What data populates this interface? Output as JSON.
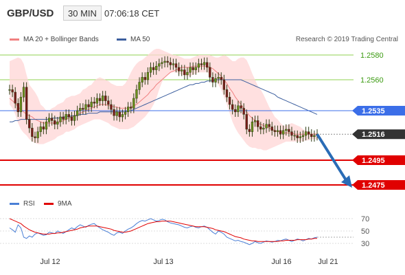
{
  "header": {
    "symbol": "GBP/USD",
    "timeframe": "30 MIN",
    "time": "07:06:18 CET"
  },
  "legend": {
    "bollinger": {
      "label": "MA 20 + Bollinger Bands",
      "color": "#f08080"
    },
    "ma50": {
      "label": "MA 50",
      "color": "#3b5e9e"
    },
    "rsi": {
      "label": "RSI",
      "color": "#4a7fd6"
    },
    "rsi_ma": {
      "label": "9MA",
      "color": "#e00000"
    }
  },
  "copyright": "Research © 2019 Trading Central",
  "chart_data": {
    "type": "candlestick",
    "y_range": [
      2.5445,
      2.559
    ],
    "price_ticks": [
      "1.2580",
      "1.2560"
    ],
    "x_ticks": [
      "Jul 12",
      "Jul 13",
      "Jul 16",
      "Jul 21"
    ],
    "closes": [
      1.2552,
      1.255,
      1.2541,
      1.2534,
      1.2546,
      1.2554,
      1.2528,
      1.2521,
      1.2514,
      1.2513,
      1.2518,
      1.2522,
      1.252,
      1.2526,
      1.2529,
      1.2527,
      1.2524,
      1.2526,
      1.253,
      1.2528,
      1.2532,
      1.253,
      1.2527,
      1.2531,
      1.2535,
      1.2537,
      1.2536,
      1.254,
      1.2538,
      1.2542,
      1.2541,
      1.2545,
      1.2543,
      1.2547,
      1.2543,
      1.254,
      1.2536,
      1.2531,
      1.2534,
      1.253,
      1.2532,
      1.2534,
      1.2538,
      1.2537,
      1.2545,
      1.2552,
      1.2558,
      1.2562,
      1.256,
      1.2566,
      1.257,
      1.2568,
      1.2571,
      1.2573,
      1.2574,
      1.2575,
      1.2574,
      1.2572,
      1.2573,
      1.257,
      1.2567,
      1.2568,
      1.2564,
      1.2566,
      1.257,
      1.2568,
      1.257,
      1.2573,
      1.2572,
      1.2574,
      1.257,
      1.2562,
      1.2558,
      1.2561,
      1.2562,
      1.256,
      1.2552,
      1.2546,
      1.254,
      1.2536,
      1.2534,
      1.2539,
      1.2537,
      1.2532,
      1.252,
      1.2518,
      1.2526,
      1.2527,
      1.2522,
      1.252,
      1.2521,
      1.2524,
      1.2522,
      1.2519,
      1.2518,
      1.2519,
      1.2516,
      1.2519,
      1.252,
      1.2518,
      1.2515,
      1.2515,
      1.2513,
      1.2514,
      1.2515,
      1.2518,
      1.2516,
      1.2514,
      1.2515,
      1.2516
    ],
    "ma20_upper": [
      1.2575,
      1.2576,
      1.2577,
      1.2578,
      1.2577,
      1.2573,
      1.2564,
      1.2556,
      1.2553,
      1.255,
      1.2546,
      1.254,
      1.2538,
      1.2535,
      1.2535,
      1.2537,
      1.2538,
      1.254,
      1.2541,
      1.2542,
      1.2545,
      1.2546,
      1.2547,
      1.2547,
      1.2548,
      1.2549,
      1.2552,
      1.2553,
      1.2555,
      1.2556,
      1.2559,
      1.2561,
      1.2562,
      1.2561,
      1.256,
      1.2559,
      1.2557,
      1.2556,
      1.2555,
      1.2555,
      1.2555,
      1.2557,
      1.2561,
      1.2566,
      1.257,
      1.2573,
      1.2575,
      1.2576,
      1.2578,
      1.258,
      1.2582,
      1.2584,
      1.2585,
      1.2585,
      1.2584,
      1.2583,
      1.2582,
      1.2581,
      1.258,
      1.258,
      1.2579,
      1.2578,
      1.2577,
      1.2577,
      1.2577,
      1.2578,
      1.2579,
      1.258,
      1.258,
      1.258,
      1.258,
      1.258,
      1.2579,
      1.2578,
      1.2578,
      1.2579,
      1.258,
      1.2579,
      1.2577,
      1.2575,
      1.2575,
      1.2577,
      1.2578,
      1.2578,
      1.2576,
      1.2571,
      1.2565,
      1.256,
      1.2555,
      1.2552,
      1.2548,
      1.2543,
      1.2538,
      1.2534,
      1.253,
      1.2528,
      1.2525,
      1.2523,
      1.2523,
      1.2524,
      1.2525,
      1.2524,
      1.2523,
      1.2522,
      1.252,
      1.2519,
      1.2518,
      1.2517,
      1.2517,
      1.2517
    ],
    "ma20_lower": [
      1.254,
      1.2537,
      1.2532,
      1.2525,
      1.252,
      1.2517,
      1.2515,
      1.2512,
      1.251,
      1.2509,
      1.2508,
      1.2508,
      1.2508,
      1.2509,
      1.251,
      1.2511,
      1.2512,
      1.2514,
      1.2515,
      1.2516,
      1.2518,
      1.2518,
      1.2519,
      1.252,
      1.2522,
      1.2523,
      1.2524,
      1.2525,
      1.2526,
      1.2527,
      1.2528,
      1.2528,
      1.2528,
      1.2527,
      1.2526,
      1.2525,
      1.2523,
      1.2522,
      1.2521,
      1.252,
      1.252,
      1.252,
      1.252,
      1.2521,
      1.2522,
      1.2524,
      1.2526,
      1.2528,
      1.253,
      1.2533,
      1.2536,
      1.254,
      1.2545,
      1.2552,
      1.2558,
      1.2562,
      1.2564,
      1.2566,
      1.2566,
      1.2566,
      1.2565,
      1.2564,
      1.2563,
      1.2563,
      1.2563,
      1.2564,
      1.2565,
      1.2566,
      1.2566,
      1.2566,
      1.2566,
      1.2565,
      1.2563,
      1.256,
      1.2556,
      1.2552,
      1.2546,
      1.254,
      1.2533,
      1.2526,
      1.2521,
      1.2517,
      1.2514,
      1.2511,
      1.2508,
      1.2506,
      1.2505,
      1.2505,
      1.2504,
      1.2504,
      1.2503,
      1.2503,
      1.2504,
      1.2505,
      1.2506,
      1.2507,
      1.2508,
      1.2509,
      1.251,
      1.251,
      1.251,
      1.251,
      1.251,
      1.251,
      1.251,
      1.2511,
      1.2511,
      1.2512,
      1.2512,
      1.2512
    ],
    "ma20": [
      1.2545,
      1.2543,
      1.2541,
      1.2538,
      1.2536,
      1.2534,
      1.2532,
      1.2531,
      1.253,
      1.2528,
      1.2527,
      1.2526,
      1.2525,
      1.2525,
      1.2525,
      1.2525,
      1.2525,
      1.2526,
      1.2526,
      1.2527,
      1.2528,
      1.2529,
      1.253,
      1.2531,
      1.2532,
      1.2533,
      1.2534,
      1.2535,
      1.2536,
      1.2537,
      1.2538,
      1.2539,
      1.254,
      1.254,
      1.254,
      1.2539,
      1.2539,
      1.2538,
      1.2538,
      1.2537,
      1.2537,
      1.2537,
      1.2537,
      1.2538,
      1.2539,
      1.254,
      1.2542,
      1.2544,
      1.2546,
      1.2548,
      1.2551,
      1.2553,
      1.2556,
      1.2558,
      1.256,
      1.2562,
      1.2564,
      1.2566,
      1.2567,
      1.2568,
      1.2569,
      1.257,
      1.257,
      1.257,
      1.257,
      1.2571,
      1.2571,
      1.2571,
      1.2571,
      1.2571,
      1.2571,
      1.257,
      1.2569,
      1.2567,
      1.2565,
      1.2563,
      1.256,
      1.2557,
      1.2553,
      1.255,
      1.2546,
      1.2543,
      1.254,
      1.2537,
      1.2534,
      1.2531,
      1.2529,
      1.2527,
      1.2525,
      1.2524,
      1.2523,
      1.2522,
      1.2521,
      1.252,
      1.2519,
      1.2518,
      1.2518,
      1.2517,
      1.2517,
      1.2517,
      1.2517,
      1.2516,
      1.2516,
      1.2516,
      1.2516,
      1.2516,
      1.2516,
      1.2516,
      1.2516,
      1.2516
    ],
    "ma50": [
      1.2526,
      1.2526,
      1.2527,
      1.2527,
      1.2528,
      1.2528,
      1.2528,
      1.2528,
      1.2528,
      1.2528,
      1.2528,
      1.2528,
      1.2528,
      1.2528,
      1.2528,
      1.2529,
      1.2529,
      1.2529,
      1.2529,
      1.253,
      1.253,
      1.253,
      1.2531,
      1.2531,
      1.2531,
      1.2532,
      1.2532,
      1.2532,
      1.2533,
      1.2533,
      1.2533,
      1.2533,
      1.2534,
      1.2534,
      1.2534,
      1.2534,
      1.2534,
      1.2534,
      1.2534,
      1.2534,
      1.2534,
      1.2534,
      1.2535,
      1.2535,
      1.2536,
      1.2537,
      1.2538,
      1.2539,
      1.254,
      1.2541,
      1.2542,
      1.2543,
      1.2544,
      1.2545,
      1.2546,
      1.2547,
      1.2548,
      1.2549,
      1.255,
      1.2551,
      1.2552,
      1.2553,
      1.2554,
      1.2555,
      1.2556,
      1.2556,
      1.2557,
      1.2557,
      1.2558,
      1.2558,
      1.2559,
      1.2559,
      1.2559,
      1.256,
      1.256,
      1.256,
      1.256,
      1.256,
      1.256,
      1.256,
      1.256,
      1.256,
      1.256,
      1.2559,
      1.2558,
      1.2557,
      1.2556,
      1.2555,
      1.2554,
      1.2553,
      1.2552,
      1.2551,
      1.255,
      1.2549,
      1.2548,
      1.2546,
      1.2545,
      1.2544,
      1.2543,
      1.2542,
      1.2541,
      1.254,
      1.2539,
      1.2538,
      1.2537,
      1.2536,
      1.2535,
      1.2534,
      1.2533,
      1.2532
    ],
    "levels": [
      {
        "value": 1.2535,
        "label": "1.2535",
        "color": "#3b6ee8"
      },
      {
        "value": 1.2516,
        "label": "1.2516",
        "color": "#333333"
      },
      {
        "value": 1.2495,
        "label": "1.2495",
        "color": "#e00000"
      },
      {
        "value": 1.2475,
        "label": "1.2475",
        "color": "#e00000"
      }
    ],
    "forecast": {
      "from": 1.2516,
      "to": 1.2475
    },
    "rsi": {
      "ticks": [
        70,
        50,
        30
      ],
      "range": [
        20,
        80
      ],
      "values": [
        55,
        52,
        48,
        60,
        55,
        40,
        38,
        42,
        40,
        45,
        47,
        45,
        43,
        44,
        48,
        47,
        46,
        50,
        48,
        46,
        49,
        52,
        55,
        53,
        57,
        60,
        58,
        56,
        59,
        61,
        62,
        58,
        55,
        52,
        50,
        48,
        45,
        43,
        47,
        48,
        46,
        50,
        53,
        55,
        58,
        62,
        65,
        67,
        66,
        68,
        70,
        68,
        66,
        67,
        69,
        68,
        65,
        63,
        62,
        61,
        60,
        58,
        56,
        55,
        57,
        58,
        56,
        55,
        57,
        58,
        56,
        52,
        48,
        45,
        50,
        48,
        45,
        40,
        38,
        36,
        34,
        35,
        33,
        32,
        30,
        28,
        30,
        33,
        31,
        30,
        32,
        34,
        33,
        32,
        33,
        35,
        34,
        36,
        37,
        35,
        33,
        35,
        37,
        36,
        34,
        36,
        38,
        37,
        39,
        40
      ],
      "ma9": [
        70,
        68,
        66,
        64,
        62,
        58,
        55,
        52,
        50,
        48,
        47,
        46,
        45,
        45,
        45,
        46,
        46,
        47,
        47,
        48,
        49,
        50,
        51,
        52,
        53,
        55,
        56,
        57,
        58,
        58,
        58,
        58,
        57,
        56,
        55,
        54,
        53,
        51,
        50,
        49,
        48,
        48,
        49,
        50,
        52,
        54,
        56,
        58,
        60,
        62,
        63,
        64,
        65,
        65,
        66,
        66,
        66,
        66,
        65,
        64,
        63,
        62,
        61,
        60,
        59,
        58,
        57,
        57,
        57,
        57,
        56,
        55,
        54,
        52,
        51,
        50,
        49,
        47,
        45,
        43,
        41,
        40,
        39,
        37,
        36,
        35,
        34,
        34,
        33,
        33,
        33,
        33,
        33,
        33,
        33,
        33,
        34,
        34,
        35,
        35,
        35,
        35,
        36,
        36,
        36,
        36,
        37,
        37,
        38,
        38
      ]
    }
  }
}
